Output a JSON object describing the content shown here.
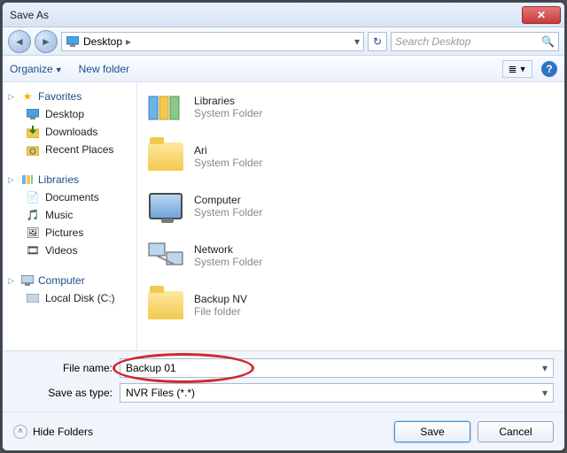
{
  "window": {
    "title": "Save As"
  },
  "nav": {
    "location_icon": "desktop",
    "location": "Desktop",
    "chevron": "▸",
    "search_placeholder": "Search Desktop"
  },
  "toolbar": {
    "organize": "Organize",
    "new_folder": "New folder"
  },
  "sidebar": {
    "favorites": {
      "label": "Favorites",
      "items": [
        "Desktop",
        "Downloads",
        "Recent Places"
      ]
    },
    "libraries": {
      "label": "Libraries",
      "items": [
        "Documents",
        "Music",
        "Pictures",
        "Videos"
      ]
    },
    "computer": {
      "label": "Computer",
      "items": [
        "Local Disk (C:)"
      ]
    }
  },
  "main_items": [
    {
      "name": "Libraries",
      "sub": "System Folder",
      "icon": "libraries"
    },
    {
      "name": "Ari",
      "sub": "System Folder",
      "icon": "user"
    },
    {
      "name": "Computer",
      "sub": "System Folder",
      "icon": "computer"
    },
    {
      "name": "Network",
      "sub": "System Folder",
      "icon": "network"
    },
    {
      "name": "Backup NV",
      "sub": "File folder",
      "icon": "folder"
    }
  ],
  "form": {
    "filename_label": "File name:",
    "filename_value": "Backup 01",
    "type_label": "Save as type:",
    "type_value": "NVR Files (*.*)"
  },
  "footer": {
    "hide_folders": "Hide Folders",
    "save": "Save",
    "cancel": "Cancel"
  }
}
